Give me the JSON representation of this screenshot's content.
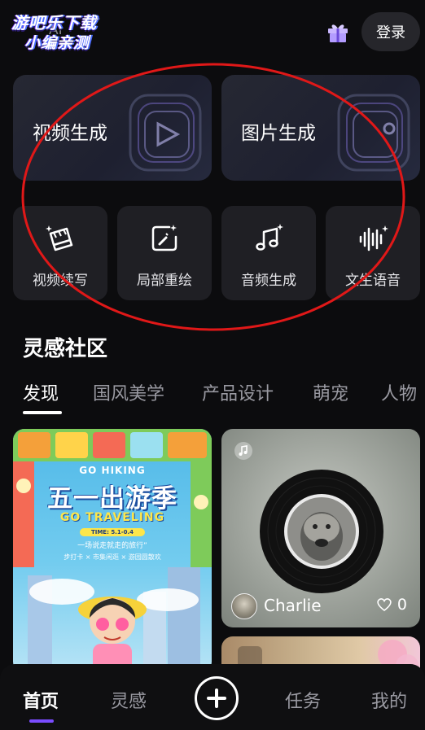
{
  "header": {
    "watermark_line1": "游吧乐下载",
    "watermark_line2": "小编亲测",
    "app_title": "AI",
    "login_label": "登录",
    "gift_icon": "gift-icon"
  },
  "features": [
    {
      "label": "视频生成",
      "icon": "play-frame-icon"
    },
    {
      "label": "图片生成",
      "icon": "image-frame-icon"
    }
  ],
  "tools": [
    {
      "label": "视频续写",
      "icon": "clapper-sparkle-icon"
    },
    {
      "label": "局部重绘",
      "icon": "image-brush-icon"
    },
    {
      "label": "音频生成",
      "icon": "music-note-sparkle-icon"
    },
    {
      "label": "文生语音",
      "icon": "waveform-sparkle-icon"
    }
  ],
  "community": {
    "title": "灵感社区",
    "tabs": [
      "发现",
      "国风美学",
      "产品设计",
      "萌宠",
      "人物"
    ],
    "active_tab": "发现"
  },
  "feed": [
    {
      "type": "poster",
      "texts": {
        "gohiking": "GO HIKING",
        "headline": "五一出游季",
        "traveling": "GO TRAVELING",
        "time": "TIME: 5.1-0.4",
        "tagline": "一场说走就走的旅行”",
        "subtags": "步打卡 × 市集闲逛 × 游园圆散欢"
      }
    },
    {
      "type": "music",
      "owner": "Charlie",
      "likes": "0"
    },
    {
      "type": "image"
    }
  ],
  "bottom_nav": {
    "items": [
      "首页",
      "灵感",
      "任务",
      "我的"
    ],
    "active": "首页",
    "create_icon": "plus-circle-icon"
  },
  "colors": {
    "background": "#0c0c0e",
    "card": "#1f1f24",
    "accent": "#7a4cff",
    "annotation": "#e01818"
  }
}
